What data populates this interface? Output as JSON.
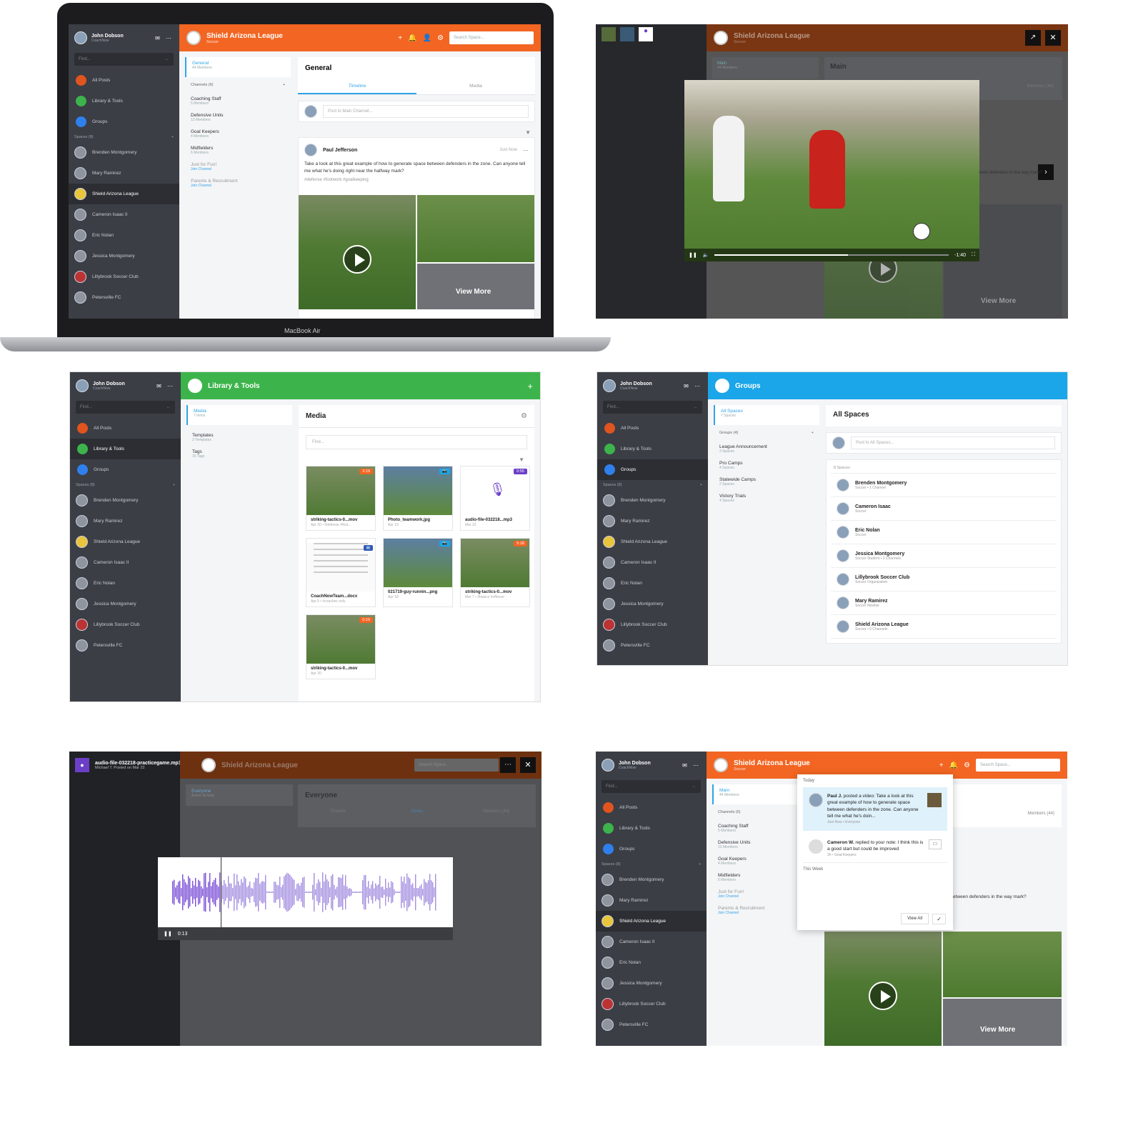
{
  "user": {
    "name": "John Dobson",
    "role": "CoachNow"
  },
  "common": {
    "find": "Find...",
    "spaces_header": "Spaces (8)",
    "search_placeholder": "Search Space..."
  },
  "nav": [
    {
      "label": "All Posts",
      "color": "#e0541f"
    },
    {
      "label": "Library & Tools",
      "color": "#3cb44b"
    },
    {
      "label": "Groups",
      "color": "#2f80ed"
    }
  ],
  "spaces": [
    "Brenden Montgomery",
    "Mary Ramirez",
    "Shield Arizona League",
    "Cameron Isaac II",
    "Eric Nolan",
    "Jessica Montgomery",
    "Lillybrook Soccer Club",
    "Petersville FC"
  ],
  "colors": {
    "orange": "#f26522",
    "green": "#3cb44b",
    "blue": "#1aa6e8",
    "purple": "#6b3fc7"
  },
  "laptop": {
    "title": "Shield Arizona League",
    "subtitle": "Soccer",
    "brand": "MacBook Air",
    "channel_selected": {
      "name": "General",
      "count": "44 Members"
    },
    "channels_header": "Channels (6)",
    "channels": [
      {
        "name": "Coaching Staff",
        "sub": "5 Members"
      },
      {
        "name": "Defensive Units",
        "sub": "13 Members"
      },
      {
        "name": "Goal Keepers",
        "sub": "4 Members"
      },
      {
        "name": "Midfielders",
        "sub": "6 Members"
      },
      {
        "name": "Just for Fun!",
        "sub": "Join Channel"
      },
      {
        "name": "Parents & Recruitment",
        "sub": "Join Channel"
      }
    ],
    "main_title": "General",
    "tabs": [
      "Timeline",
      "Media"
    ],
    "post_placeholder": "Post to Main Channel...",
    "post": {
      "author": "Paul Jefferson",
      "time": "Just Now",
      "text": "Take a look at this great example of how to generate space between defenders in the zone. Can anyone tell me what he's doing right near the halfway mark?",
      "tags": "#defense  #footwork  #goalkeeping"
    },
    "view_more": "View More"
  },
  "video": {
    "title": "Shield Arizona League",
    "subtitle": "Soccer",
    "channel": "Main",
    "channel_count": "44 Members",
    "main_title": "Main",
    "members_tab": "Members (44)",
    "time_left": "-1:40",
    "progress": 0.57,
    "snippet": "etween defenders in the way mark?",
    "view_more": "View More"
  },
  "library": {
    "title": "Library & Tools",
    "items": [
      {
        "name": "Media",
        "sub": "7 Items"
      },
      {
        "name": "Templates",
        "sub": "3 Templates"
      },
      {
        "name": "Tags",
        "sub": "15 Tags"
      }
    ],
    "main_title": "Media",
    "files": [
      {
        "name": "striking-tactics-0...mov",
        "sub": "Apr 30  •  #defense  #foot...",
        "badge": "3:19",
        "kind": "video"
      },
      {
        "name": "Photo_teamwork.jpg",
        "sub": "Apr 19",
        "badge": "",
        "kind": "photo"
      },
      {
        "name": "audio-file-032218...mp3",
        "sub": "Mar 22",
        "badge": "0:55",
        "kind": "audio"
      },
      {
        "name": "CoachNowTeam...docx",
        "sub": "Apr 5  •  #coaches only",
        "badge": "",
        "kind": "doc"
      },
      {
        "name": "021719-guy-runnin...png",
        "sub": "Apr 18",
        "badge": "",
        "kind": "photo"
      },
      {
        "name": "striking-tactics-0...mov",
        "sub": "Mar 7  •  #basics  #offense",
        "badge": "5:18",
        "kind": "video"
      },
      {
        "name": "striking-tactics-0...mov",
        "sub": "Apr 30",
        "badge": "0:19",
        "kind": "video"
      }
    ]
  },
  "groups": {
    "title": "Groups",
    "selected": {
      "name": "All Spaces",
      "sub": "7 Spaces"
    },
    "groups_header": "Groups (4)",
    "list": [
      {
        "name": "League Announcement",
        "sub": "3 Spaces"
      },
      {
        "name": "Pro Camps",
        "sub": "4 Spaces"
      },
      {
        "name": "Statewide Camps",
        "sub": "2 Spaces"
      },
      {
        "name": "Victory Trials",
        "sub": "4 Spaces"
      }
    ],
    "main_title": "All Spaces",
    "post_placeholder": "Post to All Spaces...",
    "spaces_count": "8 Spaces",
    "rows": [
      {
        "name": "Brenden Montgomery",
        "sub": "Soccer  •  1 Channel"
      },
      {
        "name": "Cameron Isaac",
        "sub": "Soccer"
      },
      {
        "name": "Eric Nolan",
        "sub": "Soccer"
      },
      {
        "name": "Jessica Montgomery",
        "sub": "Soccer Student  •  2 Channels"
      },
      {
        "name": "Lillybrook Soccer Club",
        "sub": "Soccer Organization"
      },
      {
        "name": "Mary Ramirez",
        "sub": "Soccer Newbie"
      },
      {
        "name": "Shield Arizona League",
        "sub": "Soccer  •  6 Channels"
      }
    ]
  },
  "audio": {
    "file": "audio-file-032218-practicegame.mp3",
    "meta": "Michael T. Posted on Mar 22",
    "time": "0:13",
    "channel": "Everyone",
    "channel_sub": "Active 3d Now",
    "main_title": "Everyone",
    "tabs": [
      "Timeline",
      "Media",
      "Members (44)"
    ]
  },
  "notify": {
    "today": "Today",
    "this_week": "This Week",
    "items": [
      {
        "who": "Paul J.",
        "text": "posted a video: Take a look at this great example of how to generate space between defenders in the zone. Can anyone tell me what he's doin...",
        "meta": "Just Now  •  Everyone"
      },
      {
        "who": "Cameron W.",
        "text": "replied to your note: I think this is a good start but could be improved",
        "meta": "2h  •  Goal Keepers"
      }
    ],
    "view_all": "View All",
    "members_tab": "Members (44)"
  }
}
